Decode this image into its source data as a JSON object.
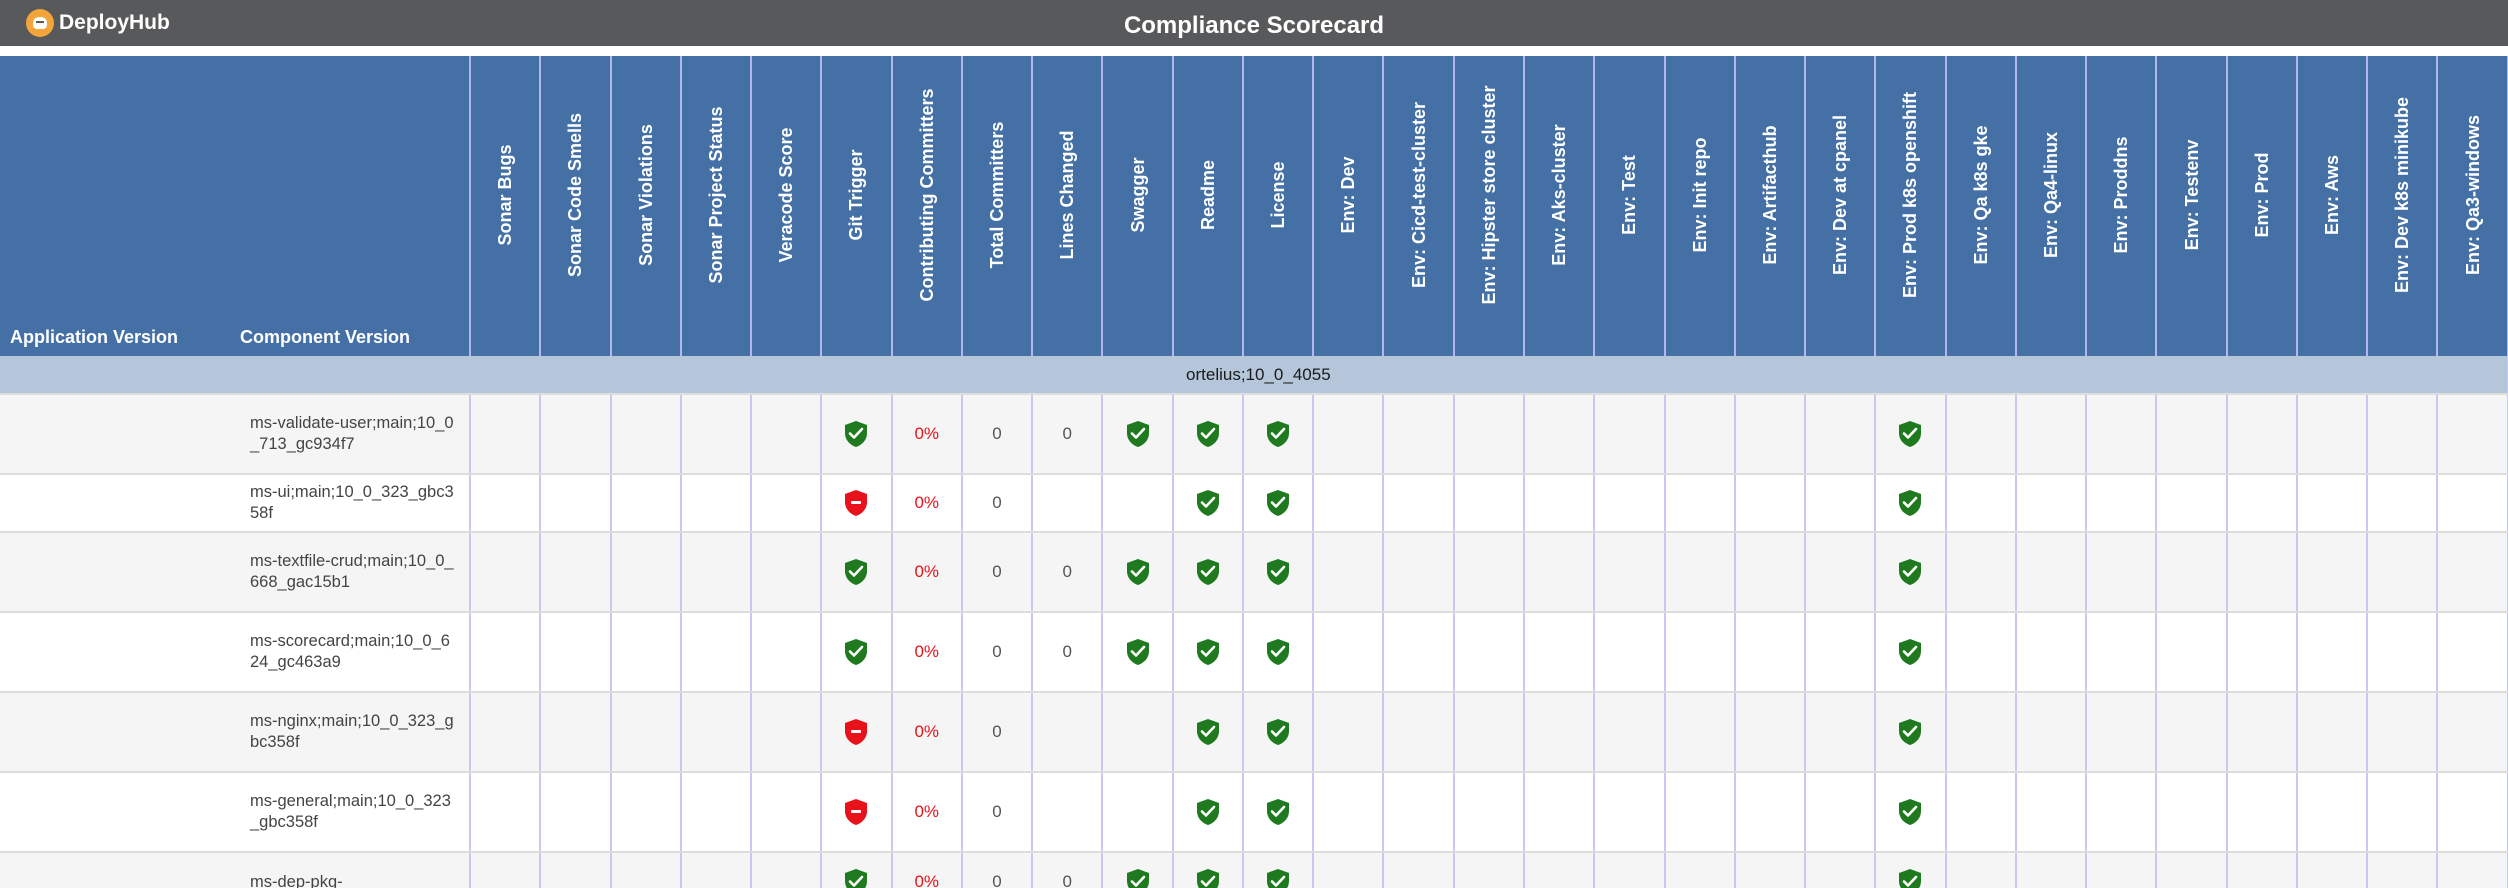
{
  "header": {
    "brand": "DeployHub",
    "title": "Compliance Scorecard"
  },
  "table": {
    "col_app": "Application Version",
    "col_component": "Component Version",
    "columns": [
      "Sonar Bugs",
      "Sonar Code Smells",
      "Sonar Violations",
      "Sonar Project Status",
      "Veracode Score",
      "Git Trigger",
      "Contributing Committers",
      "Total Committers",
      "Lines Changed",
      "Swagger",
      "Readme",
      "License",
      "Env: Dev",
      "Env: Cicd-test-cluster",
      "Env: Hipster store cluster",
      "Env: Aks-cluster",
      "Env: Test",
      "Env: Init repo",
      "Env: Artifacthub",
      "Env: Dev at cpanel",
      "Env: Prod k8s openshift",
      "Env: Qa k8s gke",
      "Env: Qa4-linux",
      "Env: Proddns",
      "Env: Testenv",
      "Env: Prod",
      "Env: Aws",
      "Env: Dev k8s minikube",
      "Env: Qa3-windows"
    ],
    "group": "ortelius;10_0_4055",
    "rows": [
      {
        "component": "ms-validate-user;main;10_0_713_gc934f7",
        "git_trigger": "pass",
        "contributing": "0%",
        "total": "0",
        "lines": "0",
        "swagger": "pass",
        "readme": "pass",
        "license": "pass",
        "prod_k8s_openshift": "pass"
      },
      {
        "component": "ms-ui;main;10_0_323_gbc358f",
        "git_trigger": "fail",
        "contributing": "0%",
        "total": "0",
        "lines": "",
        "swagger": "",
        "readme": "pass",
        "license": "pass",
        "prod_k8s_openshift": "pass"
      },
      {
        "component": "ms-textfile-crud;main;10_0_668_gac15b1",
        "git_trigger": "pass",
        "contributing": "0%",
        "total": "0",
        "lines": "0",
        "swagger": "pass",
        "readme": "pass",
        "license": "pass",
        "prod_k8s_openshift": "pass"
      },
      {
        "component": "ms-scorecard;main;10_0_624_gc463a9",
        "git_trigger": "pass",
        "contributing": "0%",
        "total": "0",
        "lines": "0",
        "swagger": "pass",
        "readme": "pass",
        "license": "pass",
        "prod_k8s_openshift": "pass"
      },
      {
        "component": "ms-nginx;main;10_0_323_gbc358f",
        "git_trigger": "fail",
        "contributing": "0%",
        "total": "0",
        "lines": "",
        "swagger": "",
        "readme": "pass",
        "license": "pass",
        "prod_k8s_openshift": "pass"
      },
      {
        "component": "ms-general;main;10_0_323_gbc358f",
        "git_trigger": "fail",
        "contributing": "0%",
        "total": "0",
        "lines": "",
        "swagger": "",
        "readme": "pass",
        "license": "pass",
        "prod_k8s_openshift": "pass"
      },
      {
        "component": "ms-dep-pkg-",
        "git_trigger": "pass",
        "contributing": "0%",
        "total": "0",
        "lines": "0",
        "swagger": "pass",
        "readme": "pass",
        "license": "pass",
        "prod_k8s_openshift": "pass"
      }
    ]
  },
  "colors": {
    "topbar": "#58595b",
    "header_bg": "#4470a6",
    "group_bg": "#b5c6da",
    "pass": "#1f7a1f",
    "fail": "#e8121b"
  },
  "icons": {
    "pass": "shield-check-icon",
    "fail": "shield-minus-icon"
  }
}
